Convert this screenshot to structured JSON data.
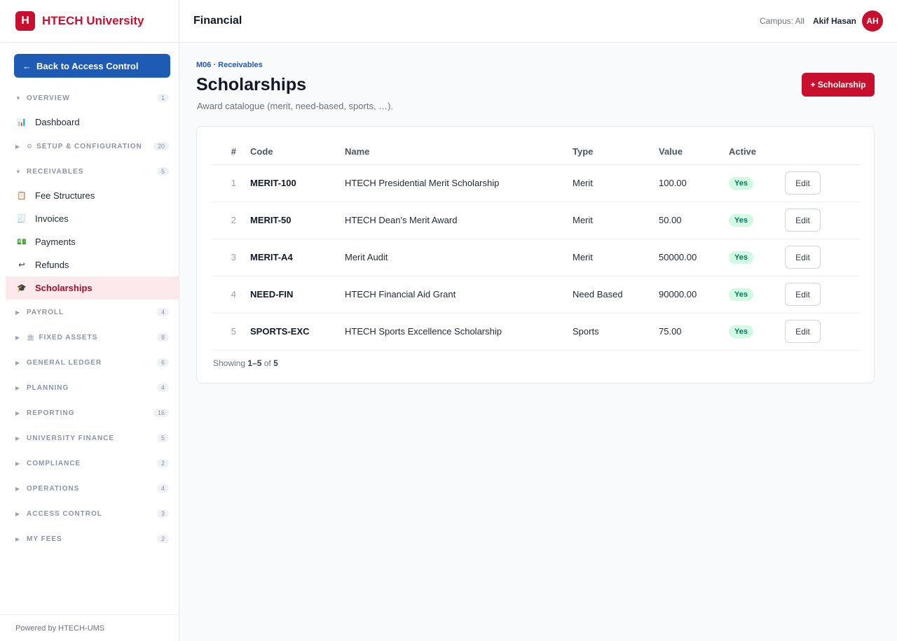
{
  "brand": {
    "logo_letter": "H",
    "name": "HTECH University",
    "color": "#c8102e"
  },
  "sidebar": {
    "back_label": "Back to Access Control",
    "back_arrow": "←",
    "groups": [
      {
        "label": "OVERVIEW",
        "count": "1",
        "expanded": true,
        "items": [
          {
            "label": "Dashboard",
            "icon": "chart-icon",
            "glyph": "📊"
          }
        ]
      },
      {
        "label": "SETUP & CONFIGURATION",
        "count": "20",
        "expanded": false,
        "icon_glyph": "⚙"
      },
      {
        "label": "RECEIVABLES",
        "count": "5",
        "expanded": true,
        "items": [
          {
            "label": "Fee Structures",
            "icon": "clipboard-icon",
            "glyph": "📋"
          },
          {
            "label": "Invoices",
            "icon": "receipt-icon",
            "glyph": "🧾"
          },
          {
            "label": "Payments",
            "icon": "money-icon",
            "glyph": "💵"
          },
          {
            "label": "Refunds",
            "icon": "return-icon",
            "glyph": "↩"
          },
          {
            "label": "Scholarships",
            "icon": "graduation-cap-icon",
            "glyph": "🎓",
            "active": true
          }
        ]
      },
      {
        "label": "PAYROLL",
        "count": "4",
        "expanded": false
      },
      {
        "label": "FIXED ASSETS",
        "count": "8",
        "expanded": false,
        "icon_glyph": "🏛"
      },
      {
        "label": "GENERAL LEDGER",
        "count": "6",
        "expanded": false
      },
      {
        "label": "PLANNING",
        "count": "4",
        "expanded": false
      },
      {
        "label": "REPORTING",
        "count": "16",
        "expanded": false
      },
      {
        "label": "UNIVERSITY FINANCE",
        "count": "5",
        "expanded": false
      },
      {
        "label": "COMPLIANCE",
        "count": "2",
        "expanded": false
      },
      {
        "label": "OPERATIONS",
        "count": "4",
        "expanded": false
      },
      {
        "label": "ACCESS CONTROL",
        "count": "3",
        "expanded": false
      },
      {
        "label": "MY FEES",
        "count": "2",
        "expanded": false
      }
    ],
    "footer": "Powered by HTECH-UMS"
  },
  "topbar": {
    "title": "Financial",
    "campus": "Campus: All",
    "user_name": "Akif Hasan",
    "avatar_initials": "AH"
  },
  "main": {
    "breadcrumb": "M06 · Receivables",
    "title": "Scholarships",
    "subtitle": "Award catalogue (merit, need-based, sports, …).",
    "add_button": "+ Scholarship",
    "table": {
      "headers": [
        "#",
        "Code",
        "Name",
        "Type",
        "Value",
        "Active"
      ],
      "rows": [
        {
          "num": "1",
          "code": "MERIT-100",
          "name": "HTECH Presidential Merit Scholarship",
          "type": "Merit",
          "value": "100.00",
          "active": "Yes"
        },
        {
          "num": "2",
          "code": "MERIT-50",
          "name": "HTECH Dean's Merit Award",
          "type": "Merit",
          "value": "50.00",
          "active": "Yes"
        },
        {
          "num": "3",
          "code": "MERIT-A4",
          "name": "Merit Audit",
          "type": "Merit",
          "value": "50000.00",
          "active": "Yes"
        },
        {
          "num": "4",
          "code": "NEED-FIN",
          "name": "HTECH Financial Aid Grant",
          "type": "Need Based",
          "value": "90000.00",
          "active": "Yes"
        },
        {
          "num": "5",
          "code": "SPORTS-EXC",
          "name": "HTECH Sports Excellence Scholarship",
          "type": "Sports",
          "value": "75.00",
          "active": "Yes"
        }
      ],
      "edit_label": "Edit"
    },
    "showing": {
      "prefix": "Showing",
      "range": "1–5",
      "of": "of",
      "total": "5"
    }
  }
}
